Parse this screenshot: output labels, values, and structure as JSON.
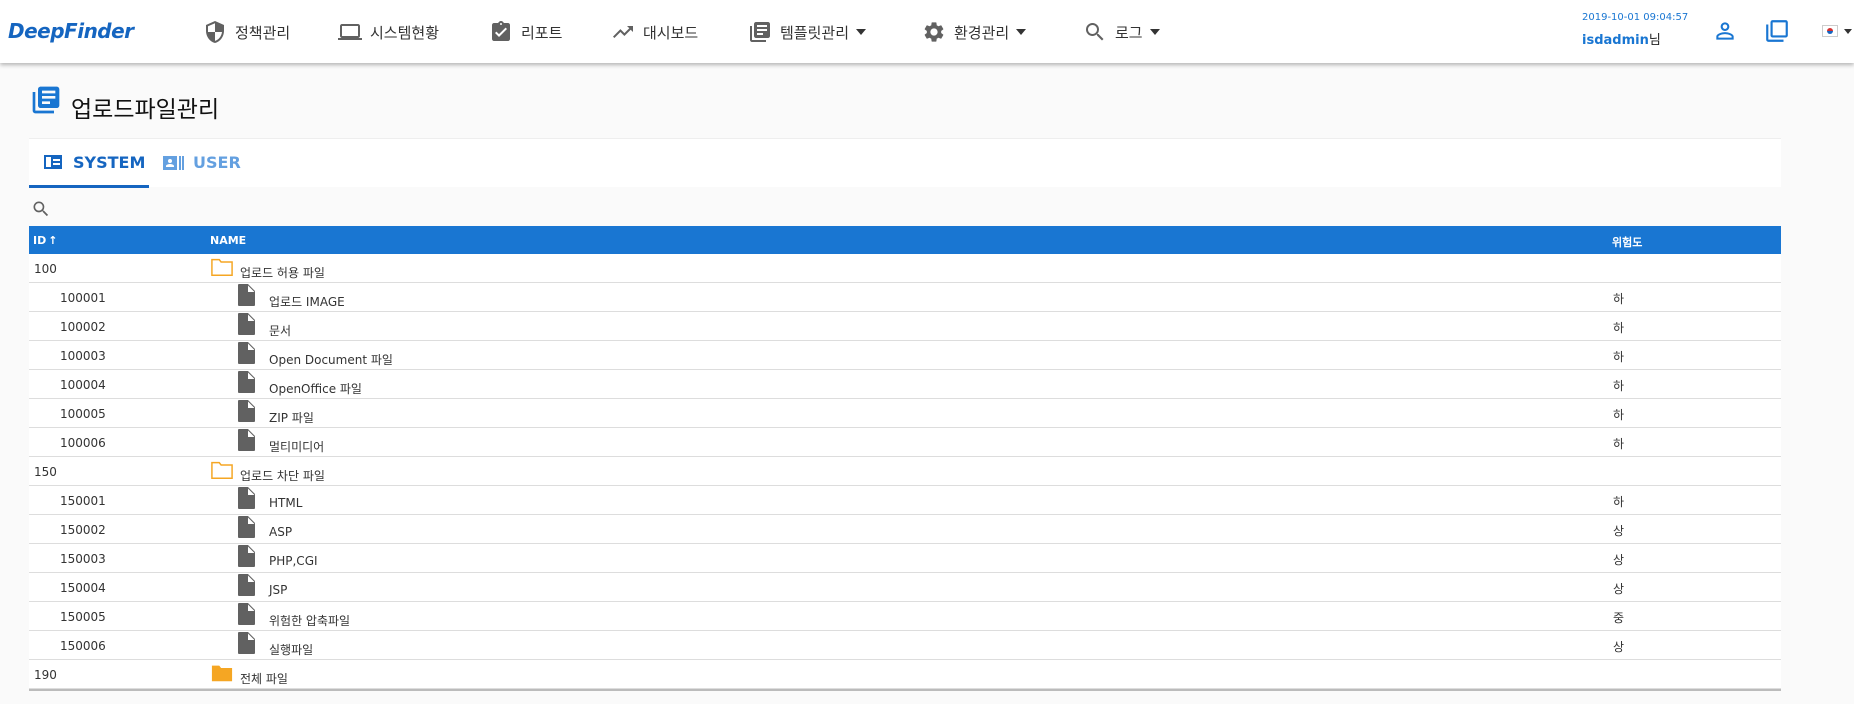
{
  "app": {
    "logo": "DeepFinder",
    "datetime": "2019-10-01 09:04:57",
    "user_name": "isdadmin",
    "user_suffix": "님"
  },
  "nav": [
    {
      "label": "정책관리",
      "icon": "shield-icon",
      "dropdown": false
    },
    {
      "label": "시스템현황",
      "icon": "laptop-icon",
      "dropdown": false
    },
    {
      "label": "리포트",
      "icon": "clipboard-check-icon",
      "dropdown": false
    },
    {
      "label": "대시보드",
      "icon": "trending-icon",
      "dropdown": false
    },
    {
      "label": "템플릿관리",
      "icon": "library-books-icon",
      "dropdown": true
    },
    {
      "label": "환경관리",
      "icon": "gear-icon",
      "dropdown": true
    },
    {
      "label": "로그",
      "icon": "search-icon",
      "dropdown": true
    }
  ],
  "page": {
    "title": "업로드파일관리"
  },
  "tabs": [
    {
      "label": "SYSTEM",
      "active": true
    },
    {
      "label": "USER",
      "active": false
    }
  ],
  "table": {
    "columns": {
      "id": "ID",
      "name": "NAME",
      "risk": "위험도"
    },
    "sort": {
      "column": "ID",
      "direction": "asc"
    },
    "rows": [
      {
        "type": "folder",
        "id": "100",
        "name": "업로드 허용 파일",
        "risk": ""
      },
      {
        "type": "file",
        "id": "100001",
        "name": "업로드 IMAGE",
        "risk": "하"
      },
      {
        "type": "file",
        "id": "100002",
        "name": "문서",
        "risk": "하"
      },
      {
        "type": "file",
        "id": "100003",
        "name": "Open Document 파일",
        "risk": "하"
      },
      {
        "type": "file",
        "id": "100004",
        "name": "OpenOffice 파일",
        "risk": "하"
      },
      {
        "type": "file",
        "id": "100005",
        "name": "ZIP 파일",
        "risk": "하"
      },
      {
        "type": "file",
        "id": "100006",
        "name": "멀티미디어",
        "risk": "하"
      },
      {
        "type": "folder",
        "id": "150",
        "name": "업로드 차단 파일",
        "risk": ""
      },
      {
        "type": "file",
        "id": "150001",
        "name": "HTML",
        "risk": "하"
      },
      {
        "type": "file",
        "id": "150002",
        "name": "ASP",
        "risk": "상"
      },
      {
        "type": "file",
        "id": "150003",
        "name": "PHP,CGI",
        "risk": "상"
      },
      {
        "type": "file",
        "id": "150004",
        "name": "JSP",
        "risk": "상"
      },
      {
        "type": "file",
        "id": "150005",
        "name": "위험한 압축파일",
        "risk": "중"
      },
      {
        "type": "file",
        "id": "150006",
        "name": "실행파일",
        "risk": "상"
      },
      {
        "type": "folder-filled",
        "id": "190",
        "name": "전체 파일",
        "risk": ""
      }
    ]
  },
  "colors": {
    "primary": "#1976d2",
    "folder": "#f5a623",
    "file_icon": "#616161"
  }
}
